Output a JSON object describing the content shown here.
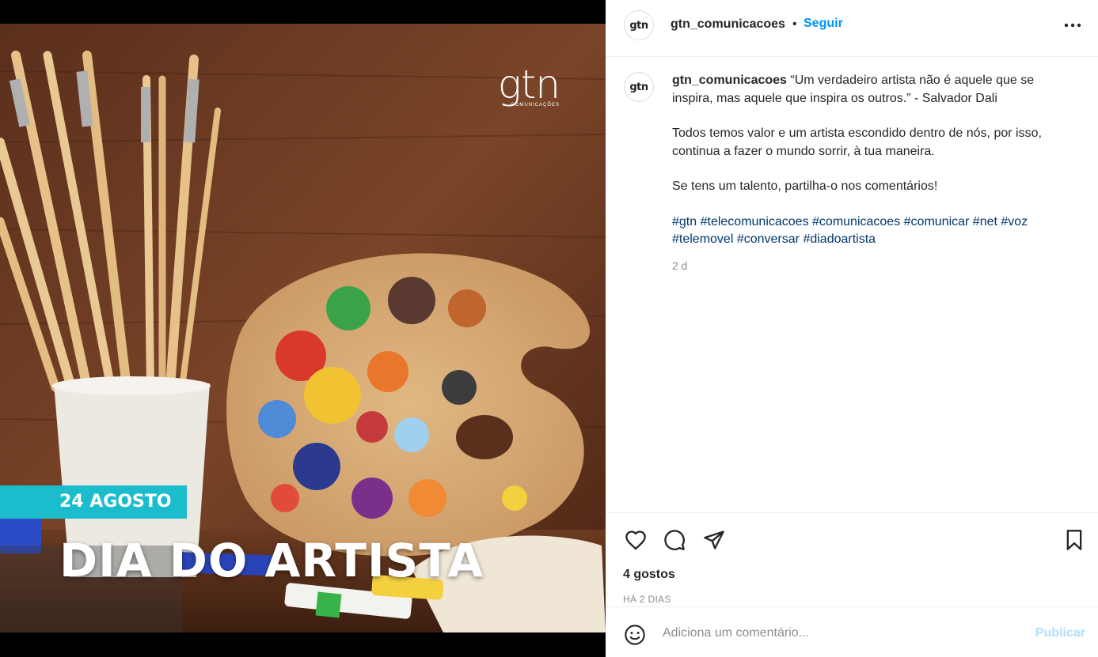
{
  "media": {
    "brand_big": "gtn",
    "brand_small": "COMUNICAÇÕES",
    "date_tag": "24 AGOSTO",
    "headline": "DIA DO ARTISTA",
    "date_color": "#1bbdcc"
  },
  "header": {
    "avatar_text": "gtn",
    "username": "gtn_comunicacoes",
    "separator": "•",
    "follow": "Seguir",
    "more_icon": "more-horizontal-icon"
  },
  "caption": {
    "avatar_text": "gtn",
    "username": "gtn_comunicacoes",
    "quote": "“Um verdadeiro artista não é aquele que se inspira, mas aquele que inspira os outros.” - Salvador Dali",
    "para2": "Todos temos valor e um artista escondido dentro de nós, por isso, continua a fazer o mundo sorrir, à tua maneira.",
    "para3": "Se tens um talento, partilha-o nos comentários!",
    "hashtags": [
      "#gtn",
      "#telecomunicacoes",
      "#comunicacoes",
      "#comunicar",
      "#net",
      "#voz",
      "#telemovel",
      "#conversar",
      "#diadoartista"
    ],
    "time": "2 d"
  },
  "actions": {
    "icons": [
      "heart-icon",
      "comment-icon",
      "share-icon",
      "bookmark-icon"
    ]
  },
  "likes": "4 gostos",
  "ago": "HÁ 2 DIAS",
  "comment": {
    "placeholder": "Adiciona um comentário...",
    "publish": "Publicar"
  },
  "colors": {
    "accent": "#0095f6",
    "hashtag": "#00376b",
    "publish_disabled": "#b2dffc"
  }
}
